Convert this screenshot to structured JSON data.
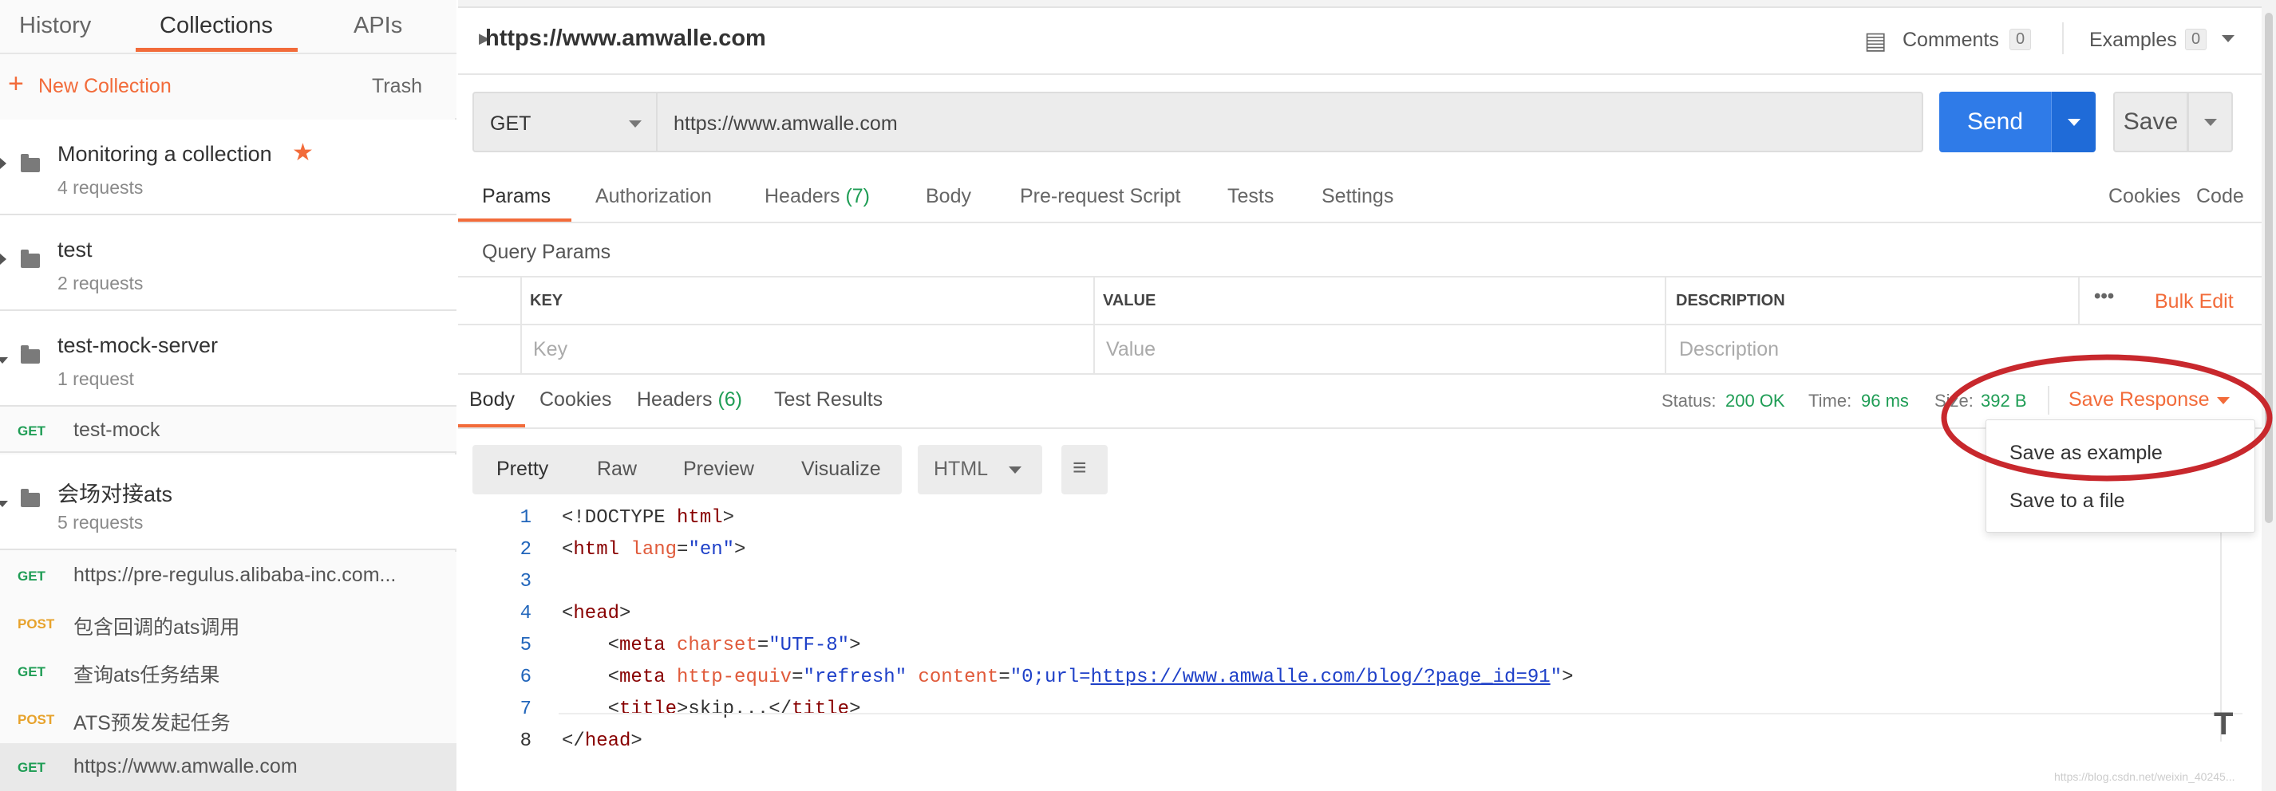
{
  "sidebar": {
    "tabs": [
      "History",
      "Collections",
      "APIs"
    ],
    "new_collection": "New Collection",
    "trash": "Trash",
    "folders": [
      {
        "name": "Monitoring a collection",
        "count": "4 requests",
        "starred": true
      },
      {
        "name": "test",
        "count": "2 requests"
      },
      {
        "name": "test-mock-server",
        "count": "1 request"
      },
      {
        "name": "会场对接ats",
        "count": "5 requests"
      }
    ],
    "mock_request": {
      "method": "GET",
      "name": "test-mock"
    },
    "requests": [
      {
        "method": "GET",
        "name": "https://pre-regulus.alibaba-inc.com..."
      },
      {
        "method": "POST",
        "name": "包含回调的ats调用"
      },
      {
        "method": "GET",
        "name": "查询ats任务结果"
      },
      {
        "method": "POST",
        "name": "ATS预发发起任务"
      },
      {
        "method": "GET",
        "name": "https://www.amwalle.com"
      }
    ]
  },
  "request": {
    "title": "https://www.amwalle.com",
    "comments_label": "Comments",
    "comments_count": "0",
    "examples_label": "Examples",
    "examples_count": "0",
    "method": "GET",
    "url": "https://www.amwalle.com",
    "send": "Send",
    "save": "Save",
    "tabs": {
      "params": "Params",
      "authorization": "Authorization",
      "headers": "Headers",
      "headers_count": "(7)",
      "body": "Body",
      "prerequest": "Pre-request Script",
      "tests": "Tests",
      "settings": "Settings",
      "cookies": "Cookies",
      "code": "Code"
    },
    "query_params_title": "Query Params",
    "table": {
      "headers": [
        "KEY",
        "VALUE",
        "DESCRIPTION"
      ],
      "placeholders": [
        "Key",
        "Value",
        "Description"
      ],
      "more": "•••",
      "bulk_edit": "Bulk Edit"
    }
  },
  "response": {
    "tabs": {
      "body": "Body",
      "cookies": "Cookies",
      "headers": "Headers",
      "headers_count": "(6)",
      "test_results": "Test Results"
    },
    "status_label": "Status:",
    "status_value": "200 OK",
    "time_label": "Time:",
    "time_value": "96 ms",
    "size_label": "Size:",
    "size_value": "392 B",
    "save_response": "Save Response",
    "view_modes": [
      "Pretty",
      "Raw",
      "Preview",
      "Visualize"
    ],
    "format": "HTML",
    "menu": [
      "Save as example",
      "Save to a file"
    ],
    "code_lines": [
      {
        "n": "1",
        "html": "&lt;!DOCTYPE <span class='tag'>html</span>&gt;"
      },
      {
        "n": "2",
        "html": "&lt;<span class='tag'>html</span> <span class='attr'>lang</span>=<span class='str'>\"en\"</span>&gt;"
      },
      {
        "n": "3",
        "html": ""
      },
      {
        "n": "4",
        "html": "&lt;<span class='tag'>head</span>&gt;"
      },
      {
        "n": "5",
        "html": "    &lt;<span class='tag'>meta</span> <span class='attr'>charset</span>=<span class='str'>\"UTF-8\"</span>&gt;"
      },
      {
        "n": "6",
        "html": "    &lt;<span class='tag'>meta</span> <span class='attr'>http-equiv</span>=<span class='str'>\"refresh\"</span> <span class='attr'>content</span>=<span class='str'>\"0;url=<span class='lnk'>https://www.amwalle.com/blog/?page_id=91</span>\"</span>&gt;"
      },
      {
        "n": "7",
        "html": "    &lt;<span class='tag'>title</span>&gt;skip...&lt;/<span class='tag'>title</span>&gt;"
      },
      {
        "n": "8",
        "html": "&lt;/<span class='tag'>head</span>&gt;"
      }
    ]
  },
  "colors": {
    "accent": "#f26b3a",
    "send": "#2f7be8",
    "annotation": "#c8282d",
    "ok": "#1f9d55"
  },
  "watermark": "https://blog.csdn.net/weixin_40245..."
}
